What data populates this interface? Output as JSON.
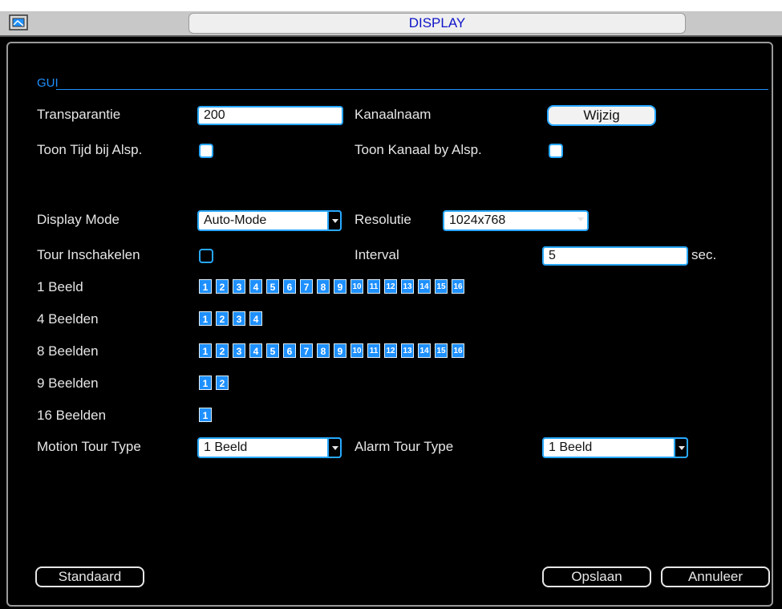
{
  "window": {
    "title": "DISPLAY"
  },
  "gui": {
    "label": "GUI"
  },
  "transparency": {
    "label": "Transparantie",
    "value": "200"
  },
  "channel_name": {
    "label": "Kanaalnaam",
    "button_label": "Wijzig"
  },
  "show_time": {
    "label": "Toon Tijd bij Alsp.",
    "checked": true
  },
  "show_channel": {
    "label": "Toon Kanaal by Alsp.",
    "checked": true
  },
  "display_mode": {
    "label": "Display Mode",
    "value": "Auto-Mode"
  },
  "resolution": {
    "label": "Resolutie",
    "value": "1024x768"
  },
  "tour": {
    "label": "Tour Inschakelen",
    "checked": false
  },
  "interval": {
    "label": "Interval",
    "value": "5",
    "unit": "sec."
  },
  "views": [
    {
      "label": "1 Beeld",
      "channels": [
        "1",
        "2",
        "3",
        "4",
        "5",
        "6",
        "7",
        "8",
        "9",
        "10",
        "11",
        "12",
        "13",
        "14",
        "15",
        "16"
      ]
    },
    {
      "label": "4 Beelden",
      "channels": [
        "1",
        "2",
        "3",
        "4"
      ]
    },
    {
      "label": "8 Beelden",
      "channels": [
        "1",
        "2",
        "3",
        "4",
        "5",
        "6",
        "7",
        "8",
        "9",
        "10",
        "11",
        "12",
        "13",
        "14",
        "15",
        "16"
      ]
    },
    {
      "label": "9 Beelden",
      "channels": [
        "1",
        "2"
      ]
    },
    {
      "label": "16 Beelden",
      "channels": [
        "1"
      ]
    }
  ],
  "motion_tour": {
    "label": "Motion Tour Type",
    "value": "1 Beeld"
  },
  "alarm_tour": {
    "label": "Alarm Tour Type",
    "value": "1 Beeld"
  },
  "buttons": {
    "default": "Standaard",
    "save": "Opslaan",
    "cancel": "Annuleer"
  }
}
